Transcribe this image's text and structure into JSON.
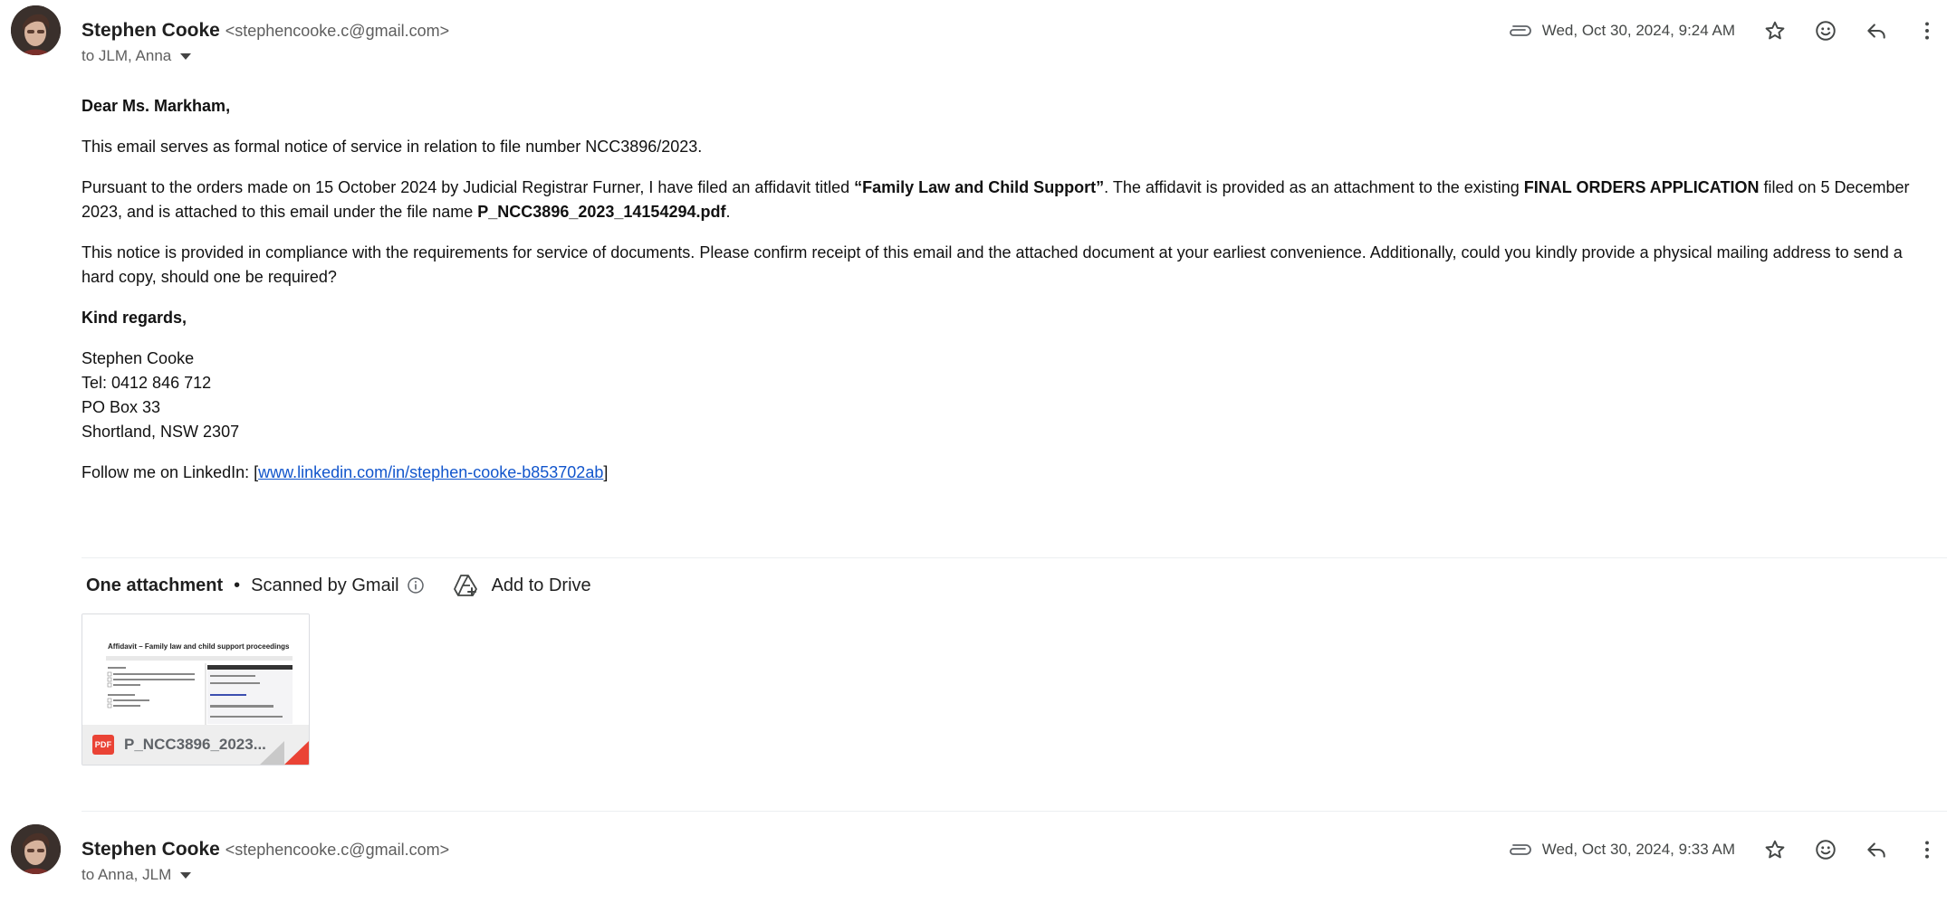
{
  "messages": [
    {
      "sender_name": "Stephen Cooke",
      "sender_email": "<stephencooke.c@gmail.com>",
      "to_label": "to JLM, Anna",
      "date": "Wed, Oct 30, 2024, 9:24 AM"
    },
    {
      "sender_name": "Stephen Cooke",
      "sender_email": "<stephencooke.c@gmail.com>",
      "to_label": "to Anna, JLM",
      "date": "Wed, Oct 30, 2024, 9:33 AM"
    }
  ],
  "body": {
    "greeting": "Dear Ms. Markham,",
    "p1": "This email serves as formal notice of service in relation to file number NCC3896/2023.",
    "p2_a": "Pursuant to the orders made on 15 October 2024 by Judicial Registrar Furner, I have filed an affidavit titled ",
    "p2_title": "“Family Law and Child Support”",
    "p2_b": ". The affidavit is provided as an attachment to the existing ",
    "p2_app": "FINAL ORDERS APPLICATION",
    "p2_c": " filed on 5 December 2023, and is attached to this email under the file name ",
    "p2_file": "P_NCC3896_2023_14154294.pdf",
    "p2_d": ".",
    "p3": "This notice is provided in compliance with the requirements for service of documents. Please confirm receipt of this email and the attached document at your earliest convenience. Additionally, could you kindly provide a physical mailing address to send a hard copy, should one be required?",
    "signoff": "Kind regards,",
    "sig_name": "Stephen Cooke",
    "sig_tel": "Tel: 0412 846 712",
    "sig_po": "PO Box 33",
    "sig_city": "Shortland, NSW 2307",
    "follow_prefix": "Follow me on LinkedIn: [",
    "follow_link": "www.linkedin.com/in/stephen-cooke-b853702ab",
    "follow_suffix": "]"
  },
  "attachments": {
    "count_label": "One attachment",
    "separator": "•",
    "scanned_label": "Scanned by Gmail",
    "add_to_drive": "Add to Drive",
    "file": {
      "type_badge": "PDF",
      "display_name": "P_NCC3896_2023...",
      "preview_title": "Affidavit – Family law and child support proceedings"
    }
  },
  "colors": {
    "link": "#1155cc",
    "pdf_red": "#ea4335",
    "secondary_text": "#5e5e5e"
  },
  "icons": [
    "attachment-clip-icon",
    "star-icon",
    "emoji-reaction-icon",
    "reply-icon",
    "more-vert-icon",
    "info-icon",
    "add-to-drive-icon",
    "pdf-icon"
  ]
}
